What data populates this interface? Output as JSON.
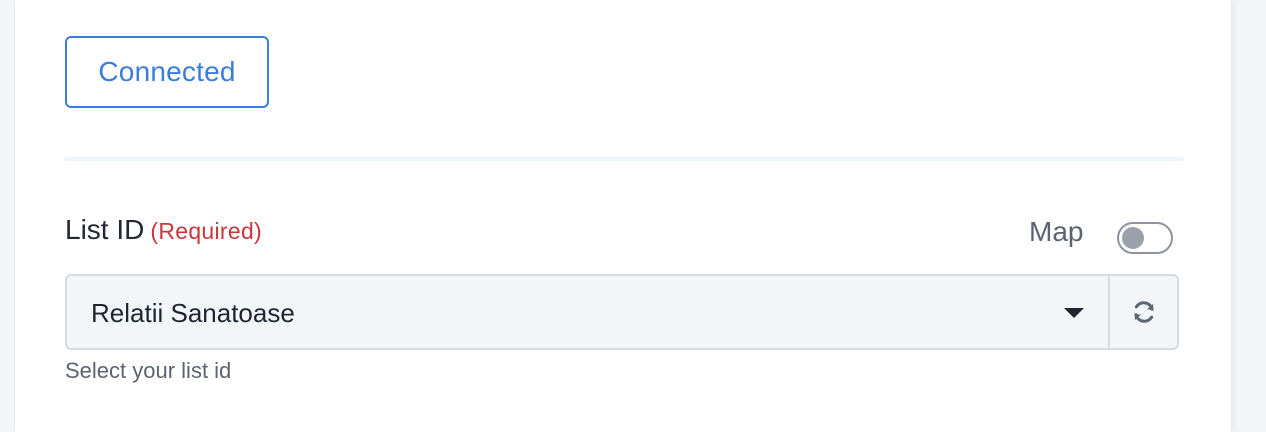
{
  "connection": {
    "status_label": "Connected"
  },
  "list_field": {
    "label": "List ID",
    "required_label": "(Required)",
    "selected_value": "Relatii Sanatoase",
    "helper_text": "Select your list id",
    "map_label": "Map",
    "map_enabled": false
  },
  "icons": {
    "select_caret": "caret-down-icon",
    "refresh": "refresh-icon"
  },
  "colors": {
    "accent": "#3b7ddd",
    "required": "#c9373d",
    "field_background": "#f3f6f9"
  }
}
